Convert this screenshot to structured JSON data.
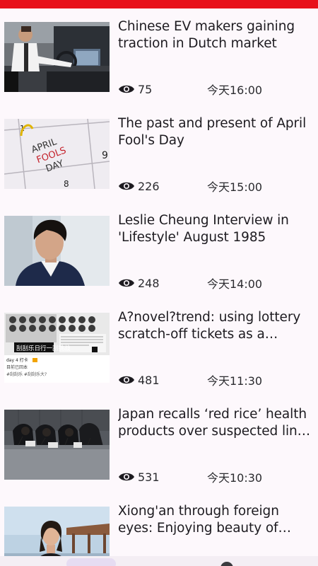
{
  "colors": {
    "status_bar": "#e8121a",
    "background": "#fdf8fc"
  },
  "view_icon": "eye-icon",
  "news": [
    {
      "title": "Chinese EV makers gaining traction in Dutch market",
      "views": "75",
      "time": "今天16:00",
      "image": "man-in-car-interior"
    },
    {
      "title": "The past and present of April Fool's Day",
      "views": "226",
      "time": "今天15:00",
      "image": "calendar-april-fools-day"
    },
    {
      "title": "Leslie Cheung Interview in 'Lifestyle' August 1985",
      "views": "248",
      "time": "今天14:00",
      "image": "portrait-man-in-suit"
    },
    {
      "title": "A?novel?trend: using lottery scratch-off tickets as a unique way to …",
      "views": "481",
      "time": "今天11:30",
      "image": "lottery-scratch-tickets",
      "image_text": {
        "banner": "刮刮乐日行一刮挑战",
        "line1": "day 4   打卡",
        "line2": "目前已回本",
        "line3": "#刮刮乐  #刮刮乐大?"
      }
    },
    {
      "title": "Japan recalls ‘red rice’ health products over suspected link to deaths",
      "views": "531",
      "time": "今天10:30",
      "image": "press-conference-bowing"
    },
    {
      "title": "Xiong'an through foreign eyes: Enjoying beauty of nature",
      "views": "",
      "time": "",
      "image": "woman-with-pavilion"
    }
  ]
}
